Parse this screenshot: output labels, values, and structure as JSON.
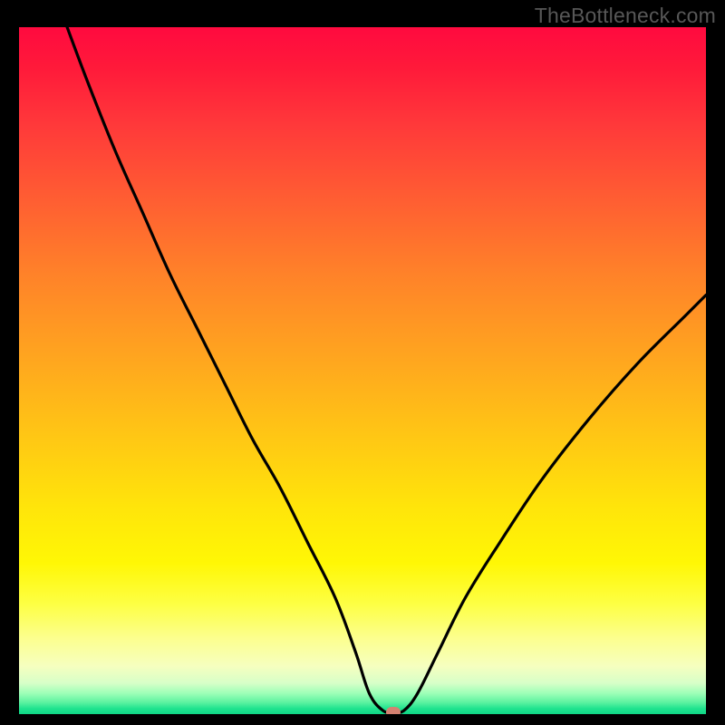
{
  "watermark": "TheBottleneck.com",
  "colors": {
    "frame": "#000000",
    "curve": "#000000",
    "marker": "#d58171",
    "watermark": "#575757"
  },
  "chart_data": {
    "type": "line",
    "title": "",
    "xlabel": "",
    "ylabel": "",
    "xlim": [
      0,
      100
    ],
    "ylim": [
      0,
      100
    ],
    "grid": false,
    "legend": false,
    "notes": "Bottleneck-style V-curve. Y is bottleneck percentage (0 at minimum, ~100 at top). Gradient background encodes severity: red high, green low. A small rounded marker sits at the curve minimum.",
    "series": [
      {
        "name": "bottleneck-curve",
        "x": [
          7,
          10,
          14,
          18,
          22,
          26,
          30,
          34,
          38,
          42,
          46,
          49,
          51,
          53,
          54.5,
          56,
          58,
          61,
          65,
          70,
          76,
          83,
          90,
          97,
          100
        ],
        "y": [
          100,
          92,
          82,
          73,
          64,
          56,
          48,
          40,
          33,
          25,
          17,
          9,
          3,
          0.5,
          0.3,
          0.5,
          3,
          9,
          17,
          25,
          34,
          43,
          51,
          58,
          61
        ]
      }
    ],
    "marker": {
      "x": 54.5,
      "y": 0.3
    }
  }
}
